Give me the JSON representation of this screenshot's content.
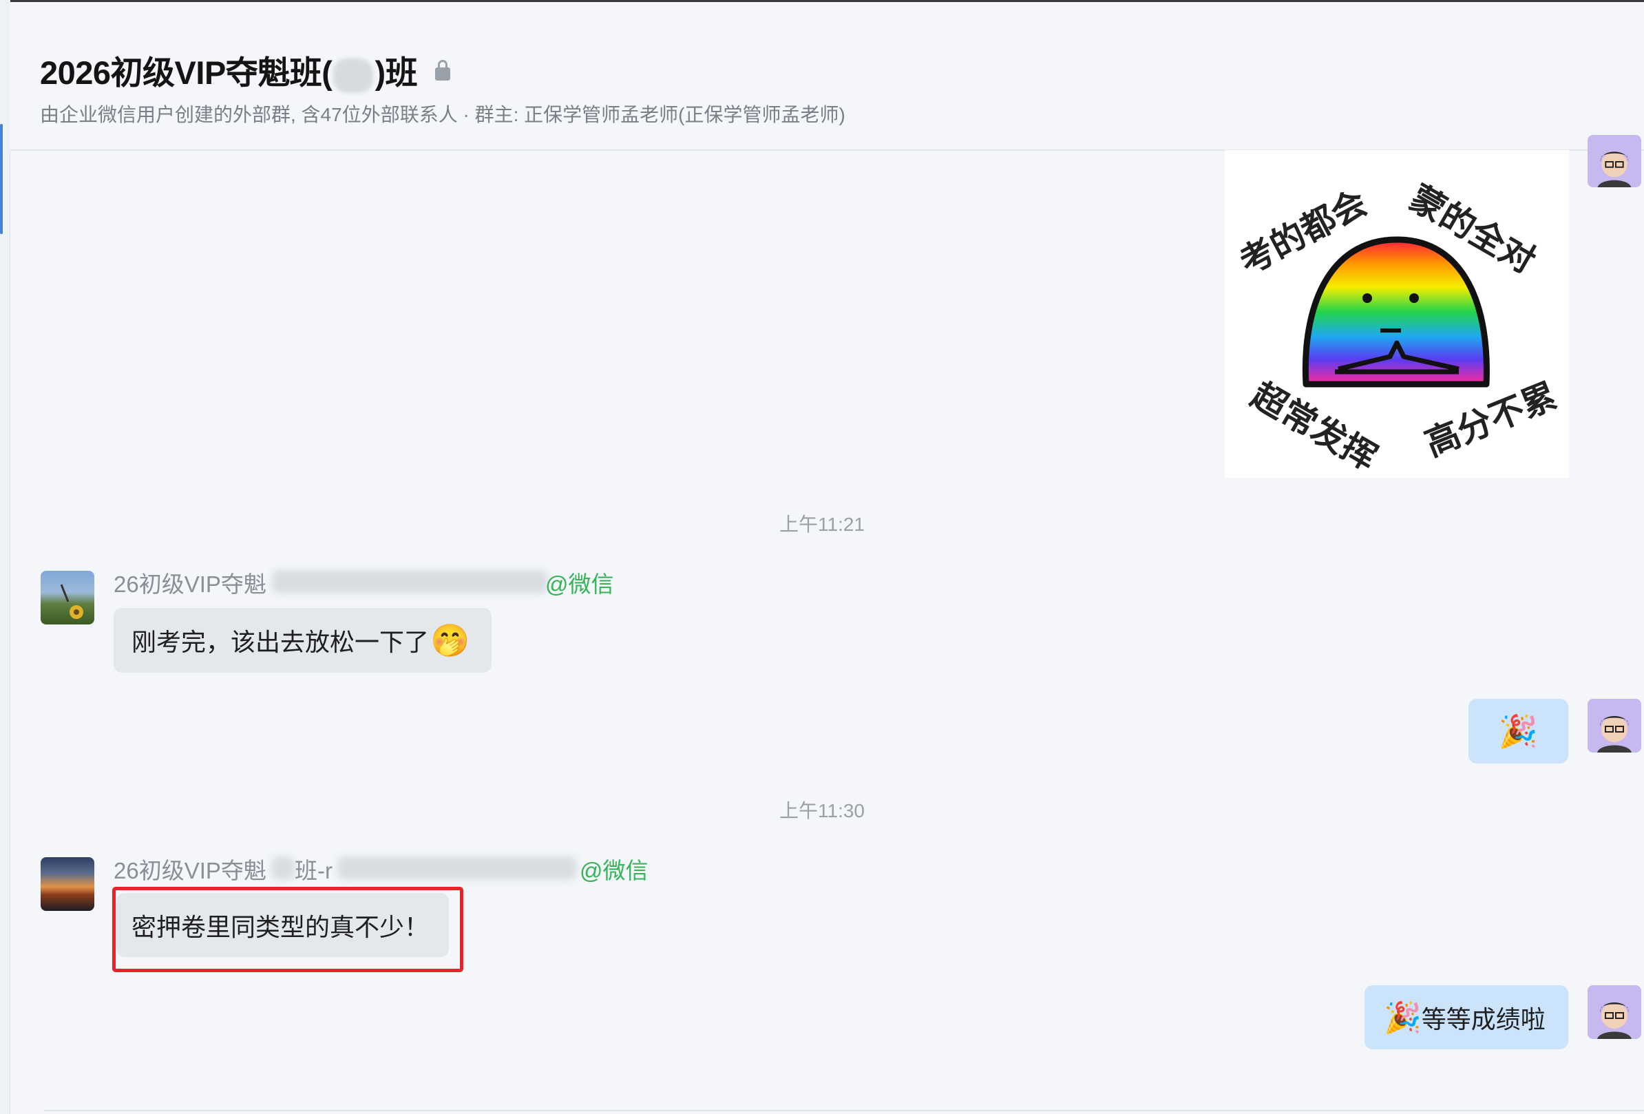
{
  "header": {
    "title_prefix": "2026初级VIP夺魁班(",
    "title_suffix": ")班",
    "lock_icon": "lock-icon",
    "subtitle": "由企业微信用户创建的外部群, 含47位外部联系人 · 群主: 正保学管师孟老师(正保学管师孟老师)"
  },
  "sticker": {
    "texts": [
      "考的都会",
      "蒙的全对",
      "超常发挥",
      "高分不累"
    ]
  },
  "messages": [
    {
      "type": "time",
      "text": "上午11:21"
    },
    {
      "type": "incoming",
      "sender_prefix": "26初级VIP夺魁",
      "sender_suffix": "",
      "source": "@微信",
      "text": "刚考完，该出去放松一下了",
      "emoji": "🤭"
    },
    {
      "type": "outgoing",
      "text": "",
      "emoji": "🎉"
    },
    {
      "type": "time",
      "text": "上午11:30"
    },
    {
      "type": "incoming",
      "sender_prefix": "26初级VIP夺魁",
      "sender_suffix": "班-r",
      "source": "@微信",
      "text": "密押卷里同类型的真不少！",
      "emoji": "",
      "highlighted": true
    },
    {
      "type": "outgoing",
      "text": "等等成绩啦",
      "emoji": "🎉"
    }
  ],
  "colors": {
    "background": "#f4f6f9",
    "incoming_bubble": "#e4e7ec",
    "outgoing_bubble": "#cbe4fb",
    "wechat_green": "#34b457",
    "highlight_red": "#e8232a"
  }
}
